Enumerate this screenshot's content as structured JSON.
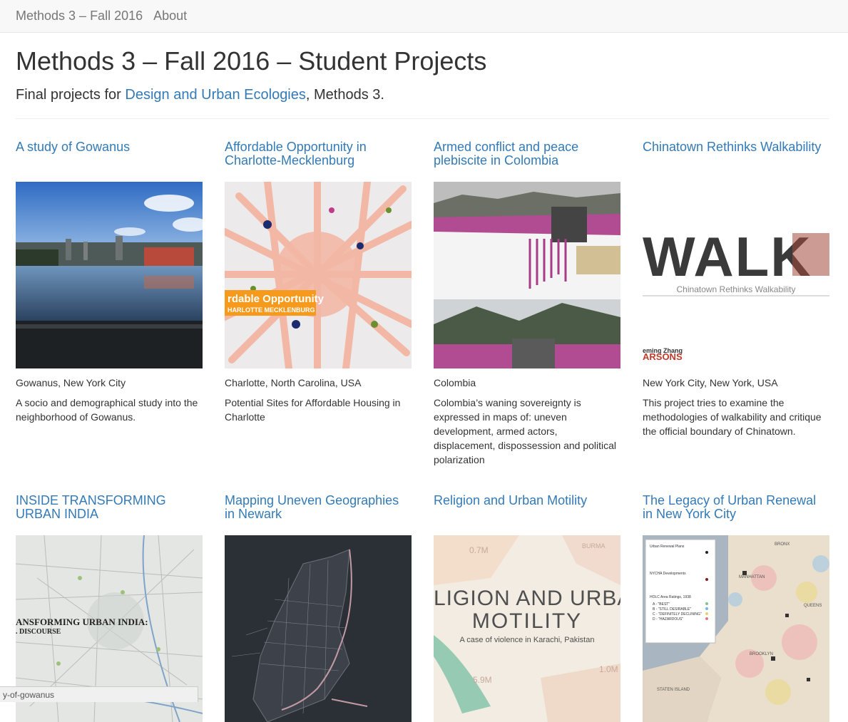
{
  "nav": {
    "brand": "Methods 3 – Fall 2016",
    "about": "About"
  },
  "page": {
    "title": "Methods 3 – Fall 2016 – Student Projects",
    "lead_prefix": "Final projects for ",
    "lead_link": "Design and Urban Ecologies",
    "lead_suffix": ", Methods 3."
  },
  "projects": [
    {
      "title": "A study of Gowanus",
      "location": "Gowanus, New York City",
      "description": "A socio and demographical study into the neighborhood of Gowanus."
    },
    {
      "title": "Affordable Opportunity in Charlotte-Mecklenburg",
      "location": "Charlotte, North Carolina, USA",
      "description": "Potential Sites for Affordable Housing in Charlotte",
      "thumb_text": [
        "rdable Opportunity",
        "HARLOTTE MECKLENBURG"
      ]
    },
    {
      "title": "Armed conflict and peace plebiscite in Colombia",
      "location": "Colombia",
      "description": "Colombia’s waning sovereignty is expressed in maps of: uneven development, armed actors, displacement, dispossession and political polarization"
    },
    {
      "title": "Chinatown Rethinks Walkability",
      "location": "New York City, New York, USA",
      "description": "This project tries to examine the methodologies of walkability and critique the official boundary of Chinatown.",
      "thumb_text": [
        "WALK",
        "Chinatown Rethinks Walkability",
        "eming Zhang",
        "ARSONS"
      ]
    },
    {
      "title": "INSIDE TRANSFORMING URBAN INDIA",
      "thumb_text": [
        "ANSFORMING URBAN INDIA:",
        ". DISCOURSE"
      ]
    },
    {
      "title": "Mapping Uneven Geographies in Newark"
    },
    {
      "title": "Religion and Urban Motility",
      "thumb_text": [
        "LIGION AND URBA",
        "MOTILITY",
        "A case of violence in Karachi, Pakistan",
        "0.7M",
        "1.0M",
        "5.9M",
        "BURMA"
      ]
    },
    {
      "title": "The Legacy of Urban Renewal in New York City",
      "thumb_text": [
        "Urban Renewal Plans",
        "NYCHA Developments",
        "HOLC Area Ratings, 1938",
        "A - \"BEST\"",
        "B - \"STILL DESIRABLE\"",
        "C - \"DEFINITELY DECLINING\"",
        "D - \"HAZARDOUS\"",
        "MANHATTAN",
        "QUEENS",
        "BROOKLYN",
        "BRONX",
        "STATEN ISLAND"
      ]
    }
  ],
  "status_url": "y-of-gowanus",
  "colors": {
    "link": "#337ab7",
    "navbar_bg": "#f8f8f8",
    "text": "#333333"
  }
}
